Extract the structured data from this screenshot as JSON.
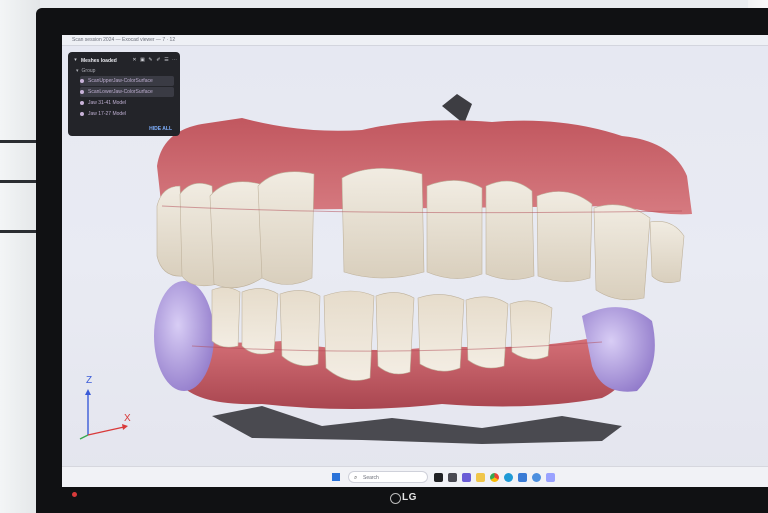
{
  "window": {
    "title": "Scan session 2024 — Exocad viewer — 7 · 12"
  },
  "mesh_panel": {
    "title": "Meshes loaded",
    "tools": [
      "close-icon",
      "folder-icon",
      "wrench-icon",
      "edit-icon",
      "list-icon",
      "more-icon"
    ],
    "group_label": "Group",
    "items": [
      {
        "label": "ScanUpperJaw-ColorSurface"
      },
      {
        "label": "ScanLowerJaw-ColorSurface"
      },
      {
        "label": "Jaw 31-41 Model"
      },
      {
        "label": "Jaw 17-27 Model"
      }
    ],
    "hide_all": "HIDE ALL"
  },
  "axis": {
    "z": "Z",
    "x": "X"
  },
  "taskbar": {
    "search_placeholder": "Search"
  },
  "monitor": {
    "brand": "LG"
  },
  "colors": {
    "panel_bg": "#232429",
    "gum": "#c9606b",
    "tooth": "#e9e3d6",
    "bite_block": "#b9a5e4",
    "accent_link": "#7fb0ff"
  }
}
